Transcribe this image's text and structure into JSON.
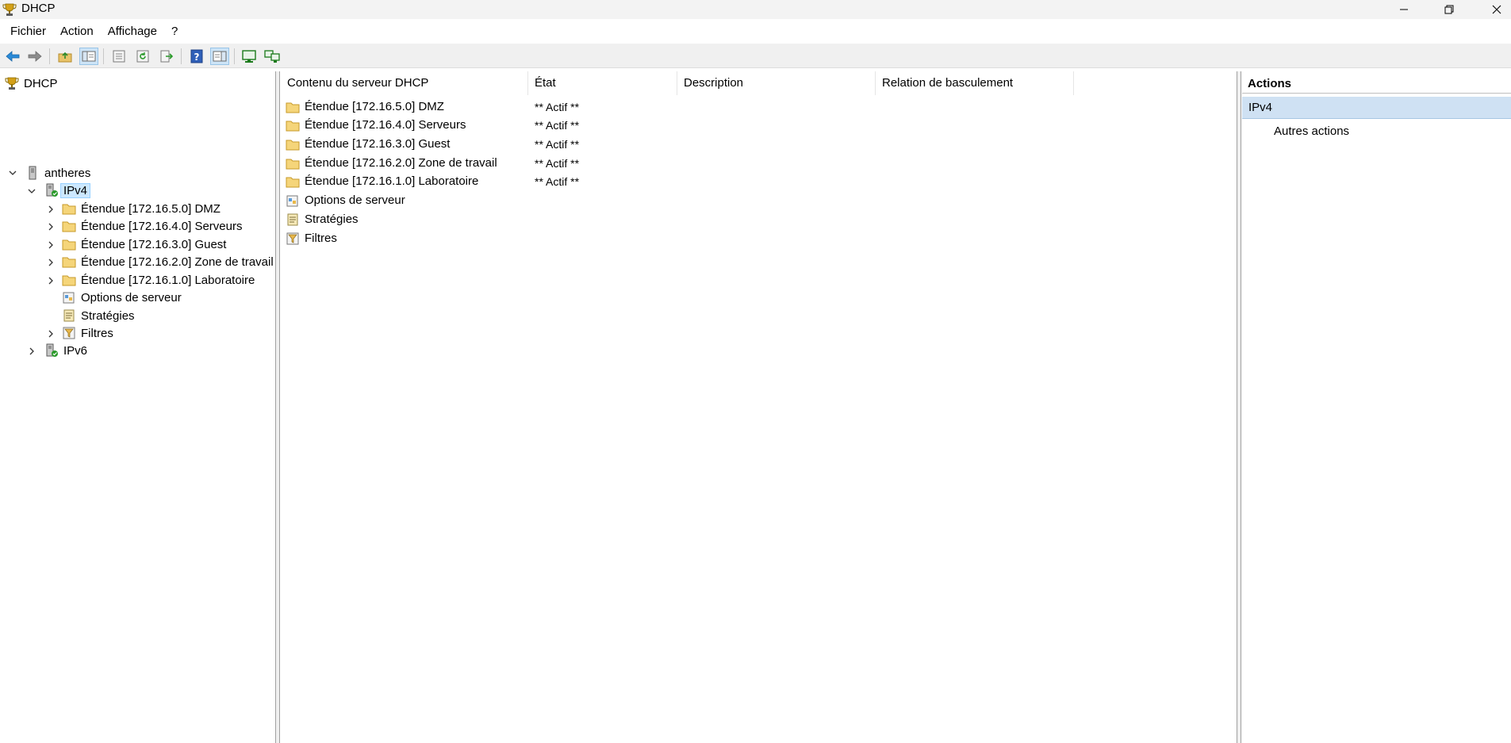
{
  "window": {
    "title": "DHCP",
    "icons": {
      "app": "dhcp-trophy-icon",
      "minimize": "minimize-icon",
      "restore": "restore-icon",
      "close": "close-icon"
    }
  },
  "menu": {
    "items": [
      "Fichier",
      "Action",
      "Affichage",
      "?"
    ]
  },
  "toolbar": {
    "buttons": [
      {
        "name": "back-arrow-icon"
      },
      {
        "name": "forward-arrow-icon"
      },
      {
        "name": "up-folder-icon"
      },
      {
        "name": "show-hide-tree-icon",
        "pressed": true
      },
      {
        "name": "properties-icon"
      },
      {
        "name": "refresh-icon"
      },
      {
        "name": "export-list-icon"
      },
      {
        "name": "help-icon"
      },
      {
        "name": "show-hide-action-pane-icon",
        "pressed": true
      },
      {
        "name": "monitor-icon"
      },
      {
        "name": "network-monitor-icon"
      }
    ]
  },
  "tree": {
    "root": "DHCP",
    "server": "antheres",
    "ipv4": "IPv4",
    "ipv4_children": [
      "Étendue [172.16.5.0] DMZ",
      "Étendue [172.16.4.0] Serveurs",
      "Étendue [172.16.3.0] Guest",
      "Étendue [172.16.2.0] Zone de travail",
      "Étendue [172.16.1.0] Laboratoire",
      "Options de serveur",
      "Stratégies",
      "Filtres"
    ],
    "ipv6": "IPv6"
  },
  "list": {
    "headers": [
      "Contenu du serveur DHCP",
      "État",
      "Description",
      "Relation de basculement"
    ],
    "rows": [
      {
        "name": "Étendue [172.16.5.0] DMZ",
        "state": "** Actif **",
        "icon": "folder-icon"
      },
      {
        "name": "Étendue [172.16.4.0] Serveurs",
        "state": "** Actif **",
        "icon": "folder-icon"
      },
      {
        "name": "Étendue [172.16.3.0] Guest",
        "state": "** Actif **",
        "icon": "folder-icon"
      },
      {
        "name": "Étendue [172.16.2.0] Zone de travail",
        "state": "** Actif **",
        "icon": "folder-icon"
      },
      {
        "name": "Étendue [172.16.1.0] Laboratoire",
        "state": "** Actif **",
        "icon": "folder-icon"
      },
      {
        "name": "Options de serveur",
        "state": "",
        "icon": "server-options-icon"
      },
      {
        "name": "Stratégies",
        "state": "",
        "icon": "policies-icon"
      },
      {
        "name": "Filtres",
        "state": "",
        "icon": "filter-icon"
      }
    ]
  },
  "actions": {
    "title": "Actions",
    "section": "IPv4",
    "items": [
      "Autres actions"
    ]
  }
}
